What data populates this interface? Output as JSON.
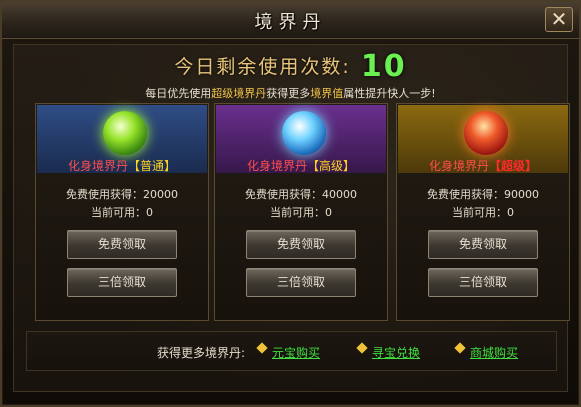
{
  "window": {
    "title": "境界丹",
    "close_label": "✕"
  },
  "uses": {
    "label": "今日剩余使用次数:",
    "count": "10"
  },
  "tip": {
    "part1": "每日优先使用",
    "highlight1": "超级境界丹",
    "part2": "获得更多",
    "highlight2": "境界值",
    "part3": "属性提升快人一步!"
  },
  "cards": [
    {
      "name": "化身境界丹",
      "grade": "【普通】",
      "free_gain": "免费使用获得：20000",
      "available": "当前可用：0",
      "claim_label": "免费领取",
      "triple_label": "三倍领取",
      "orb_color": "#97e42c"
    },
    {
      "name": "化身境界丹",
      "grade": "【高级】",
      "free_gain": "免费使用获得：40000",
      "available": "当前可用：0",
      "claim_label": "免费领取",
      "triple_label": "三倍领取",
      "orb_color": "#6fd2ff"
    },
    {
      "name": "化身境界丹",
      "grade": "【超级】",
      "free_gain": "免费使用获得：90000",
      "available": "当前可用：0",
      "claim_label": "免费领取",
      "triple_label": "三倍领取",
      "orb_color": "#f05a2a"
    }
  ],
  "footer": {
    "label": "获得更多境界丹:",
    "links": [
      "元宝购买",
      "寻宝兑换",
      "商城购买"
    ]
  }
}
